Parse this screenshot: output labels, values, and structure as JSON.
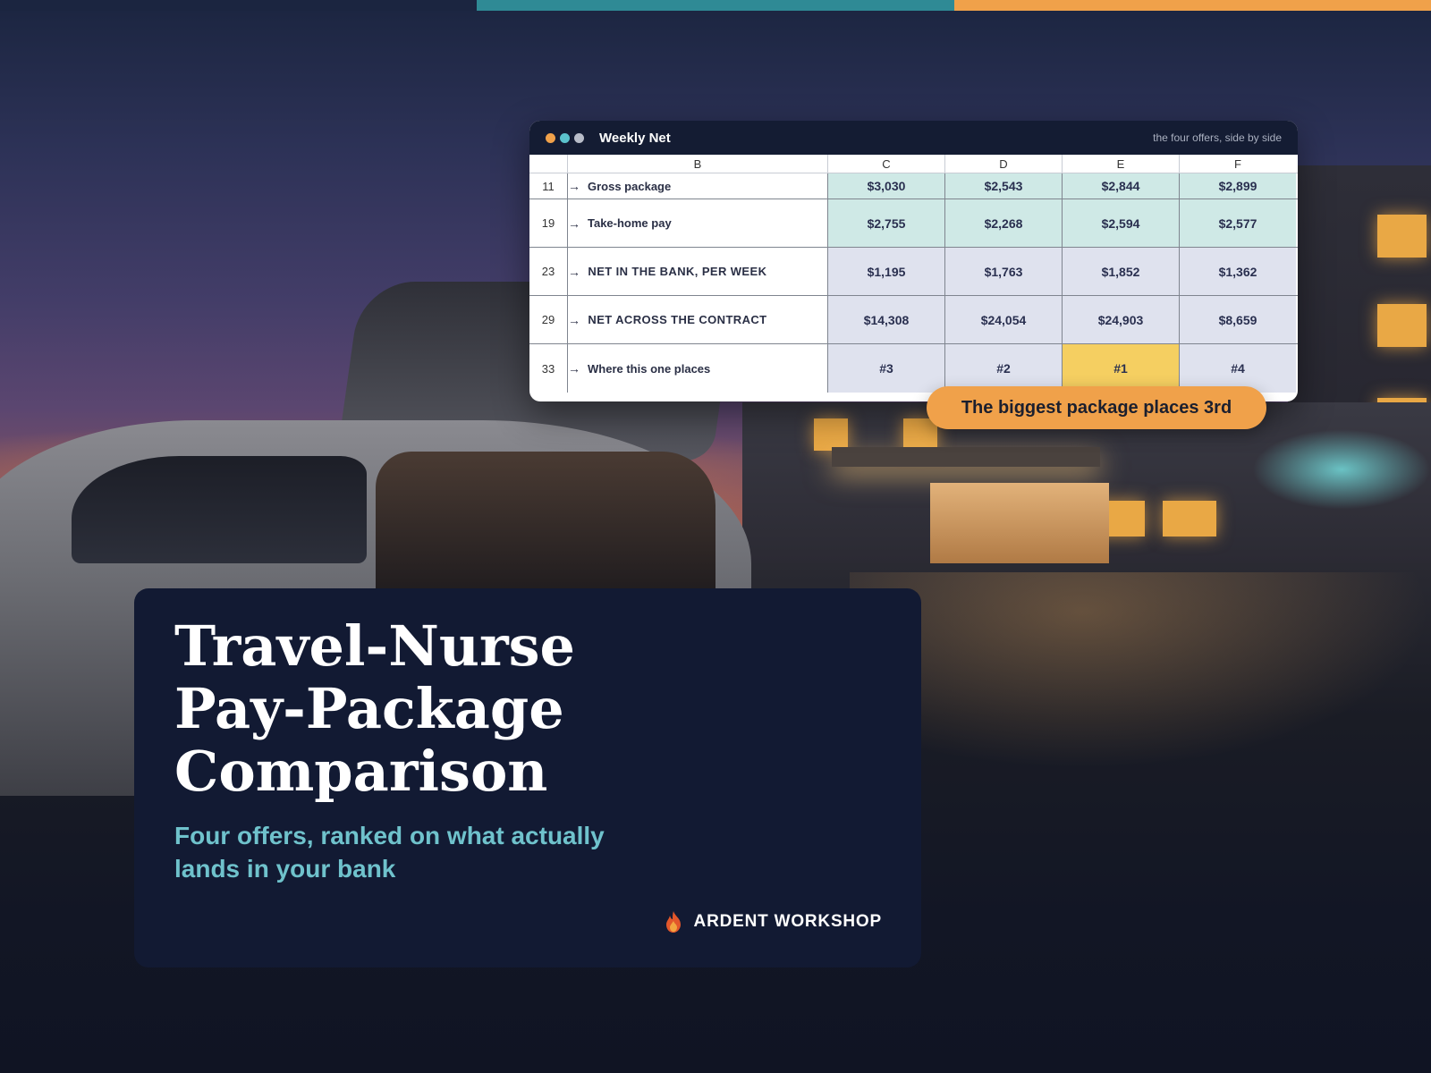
{
  "sheet": {
    "title": "Weekly Net",
    "subtitle": "the four offers, side by side",
    "columns": [
      "B",
      "C",
      "D",
      "E",
      "F"
    ],
    "rows": [
      {
        "num": "11",
        "label": "Gross package",
        "values": [
          "$3,030",
          "$2,543",
          "$2,844",
          "$2,899"
        ]
      },
      {
        "num": "19",
        "label": "Take-home pay",
        "values": [
          "$2,755",
          "$2,268",
          "$2,594",
          "$2,577"
        ]
      },
      {
        "num": "23",
        "label": "NET IN THE BANK, PER WEEK",
        "values": [
          "$1,195",
          "$1,763",
          "$1,852",
          "$1,362"
        ]
      },
      {
        "num": "29",
        "label": "NET ACROSS THE CONTRACT",
        "values": [
          "$14,308",
          "$24,054",
          "$24,903",
          "$8,659"
        ]
      },
      {
        "num": "33",
        "label": "Where this one places",
        "values": [
          "#3",
          "#2",
          "#1",
          "#4"
        ]
      }
    ]
  },
  "callout": "The biggest package places 3rd",
  "card": {
    "title_lines": [
      "Travel-Nurse",
      "Pay-Package",
      "Comparison"
    ],
    "subtitle": "Four offers, ranked on what actually lands in your bank",
    "brand": "ARDENT WORKSHOP"
  },
  "colors": {
    "teal_stripe": "#2f8a95",
    "orange_stripe": "#f0a14a",
    "card_bg": "#121a33",
    "subtitle": "#6fc2cc",
    "highlight_gold": "#f5cf61",
    "teal_cell": "#cfe9e6",
    "lavender_cell": "#dfe2ee"
  },
  "icons": [
    "arrow-right-icon",
    "flame-icon",
    "window-dot-icon"
  ]
}
